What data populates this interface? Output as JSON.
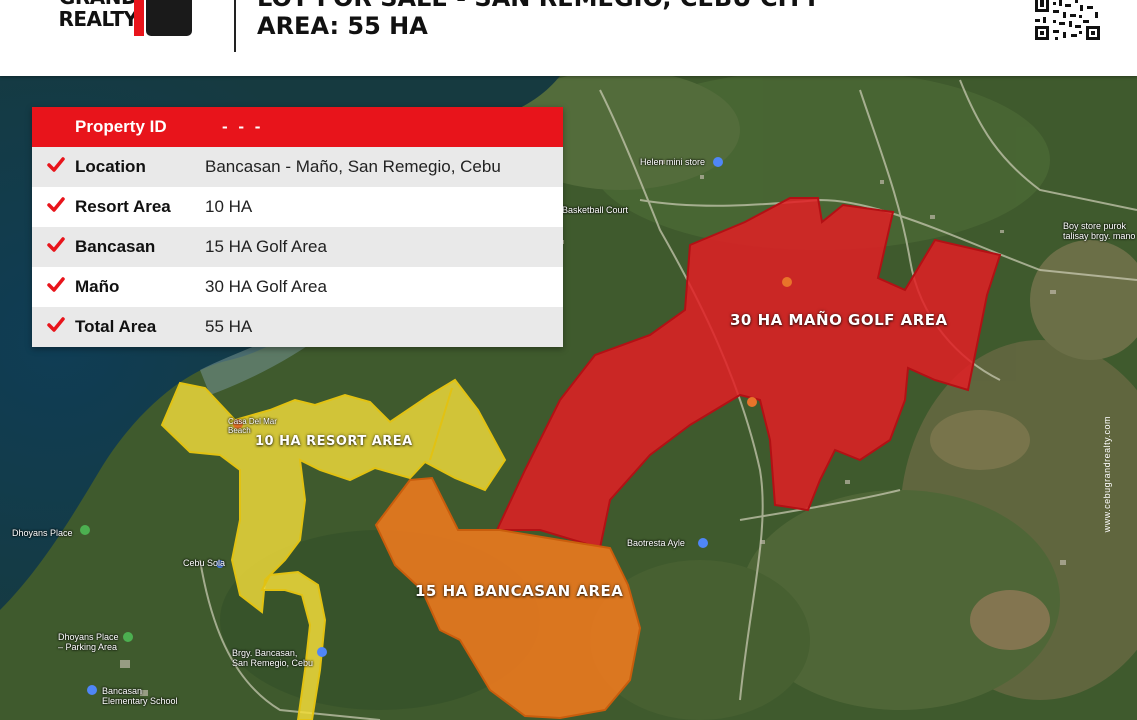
{
  "header": {
    "logo_line1": "GRAND",
    "logo_line2": "REALTY",
    "title_line1": "LOT FOR SALE - SAN REMEGIO, CEBU CITY",
    "title_line2": "AREA:  55 HA"
  },
  "info_table": {
    "property_id_label": "Property ID",
    "property_id_value": "- - -",
    "rows": [
      {
        "label": "Location",
        "value": "Bancasan - Maño, San Remegio, Cebu"
      },
      {
        "label": "Resort Area",
        "value": "10 HA"
      },
      {
        "label": "Bancasan",
        "value": "15 HA Golf Area"
      },
      {
        "label": "Maño",
        "value": "30 HA Golf Area"
      },
      {
        "label": "Total Area",
        "value": "55 HA"
      }
    ],
    "check_icon": "check-icon"
  },
  "areas": {
    "resort": "10 HA RESORT AREA",
    "bancasan": "15 HA BANCASAN AREA",
    "mano": "30 HA MAÑO GOLF AREA"
  },
  "places": {
    "dhoyans": "Dhoyans Place",
    "dhoyans_parking": "Dhoyans Place\n– Parking Area",
    "cebu_sola": "Cebu Sola",
    "brgy": "Brgy. Bancasan,\nSan Remegio, Cebu",
    "school": "Bancasan\nElementary School",
    "helen": "Helen mini store",
    "basketball": "Basketball Court",
    "sari_sari": "Boy store purok\ntalisay brgy. mano",
    "baotresta": "Baotresta Ayle",
    "casa": "Casa Del Mar\nBeach"
  },
  "watermark": "www.cebugrandrealty.com",
  "colors": {
    "brand_red": "#e8141b",
    "mano_area": "#e31e24",
    "bancasan_area": "#f07a1e",
    "resort_area": "#f2dc3a"
  }
}
